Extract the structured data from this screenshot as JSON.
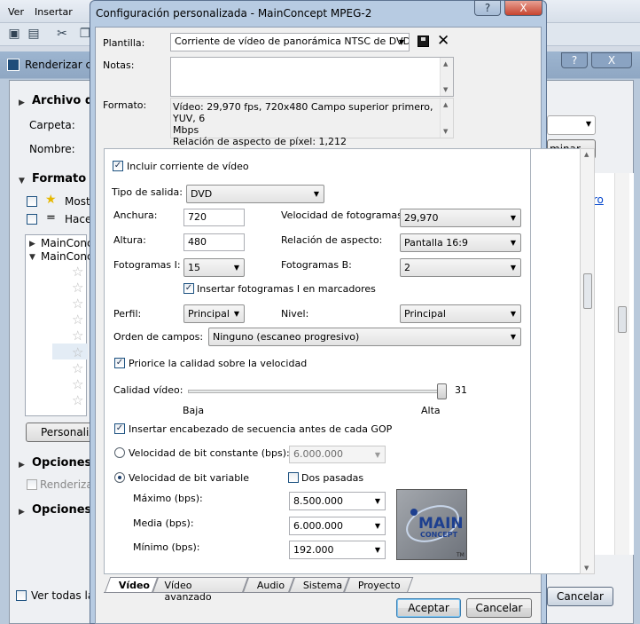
{
  "app": {
    "menu": [
      "Ver",
      "Insertar"
    ]
  },
  "render_window": {
    "title": "Renderizar co",
    "sections": {
      "archivo": "Archivo d",
      "formato": "Formato d",
      "opciones1": "Opciones",
      "opciones2": "Opciones"
    },
    "labels": {
      "carpeta": "Carpeta:",
      "nombre": "Nombre:",
      "mostrar": "Most",
      "hacer": "Hace",
      "renderizar": "Renderizar",
      "ver_todas": "Ver todas la"
    },
    "tree_items": [
      "MainConcep",
      "MainConcep"
    ],
    "buttons": {
      "eliminar": "minar...",
      "personalizar": "Personaliz",
      "cancelar": "Cancelar"
    },
    "filter_link": "es de filtro",
    "help": "?",
    "close": "X"
  },
  "dialog": {
    "title": "Configuración personalizada - MainConcept MPEG-2",
    "help": "?",
    "close": "X",
    "plantilla_label": "Plantilla:",
    "plantilla_value": "Corriente de vídeo de panorámica NTSC de DVD An",
    "notas_label": "Notas:",
    "notas_value": "",
    "formato_label": "Formato:",
    "formato_value_1": "Vídeo: 29,970 fps, 720x480 Campo superior primero, YUV, 6",
    "formato_value_2": "Mbps",
    "formato_value_3": "Relación de aspecto de píxel: 1,212",
    "incluir_video": "Incluir corriente de vídeo",
    "tipo_salida_label": "Tipo de salida:",
    "tipo_salida": "DVD",
    "anchura_label": "Anchura:",
    "anchura": "720",
    "altura_label": "Altura:",
    "altura": "480",
    "fotogramas_i_label": "Fotogramas I:",
    "fotogramas_i": "15",
    "velocidad_fotogramas_label": "Velocidad de fotogramas:",
    "velocidad_fotogramas": "29,970",
    "relacion_aspecto_label": "Relación de aspecto:",
    "relacion_aspecto": "Pantalla 16:9",
    "fotogramas_b_label": "Fotogramas B:",
    "fotogramas_b": "2",
    "insertar_fotogramas_i": "Insertar fotogramas I en marcadores",
    "perfil_label": "Perfil:",
    "perfil": "Principal",
    "nivel_label": "Nivel:",
    "nivel": "Principal",
    "orden_campos_label": "Orden de campos:",
    "orden_campos": "Ninguno (escaneo progresivo)",
    "priorice": "Priorice la calidad sobre la velocidad",
    "calidad_label": "Calidad vídeo:",
    "calidad_value": "31",
    "calidad_level": 1.0,
    "calidad_baja": "Baja",
    "calidad_alta": "Alta",
    "insertar_encabezado": "Insertar encabezado de secuencia antes de cada GOP",
    "vbr_constante_label": "Velocidad de bit constante (bps):",
    "vbr_constante": "6.000.000",
    "vbr_variable_label": "Velocidad de bit variable",
    "dos_pasadas": "Dos pasadas",
    "maximo_label": "Máximo (bps):",
    "maximo": "8.500.000",
    "media_label": "Media (bps):",
    "media": "6.000.000",
    "minimo_label": "Mínimo (bps):",
    "minimo": "192.000",
    "logo_text_1": "MAIN",
    "logo_text_2": "CONCEPT",
    "logo_tm": "TM",
    "tabs": [
      "Vídeo",
      "Vídeo avanzado",
      "Audio",
      "Sistema",
      "Proyecto"
    ],
    "aceptar": "Aceptar",
    "cancelar": "Cancelar"
  }
}
